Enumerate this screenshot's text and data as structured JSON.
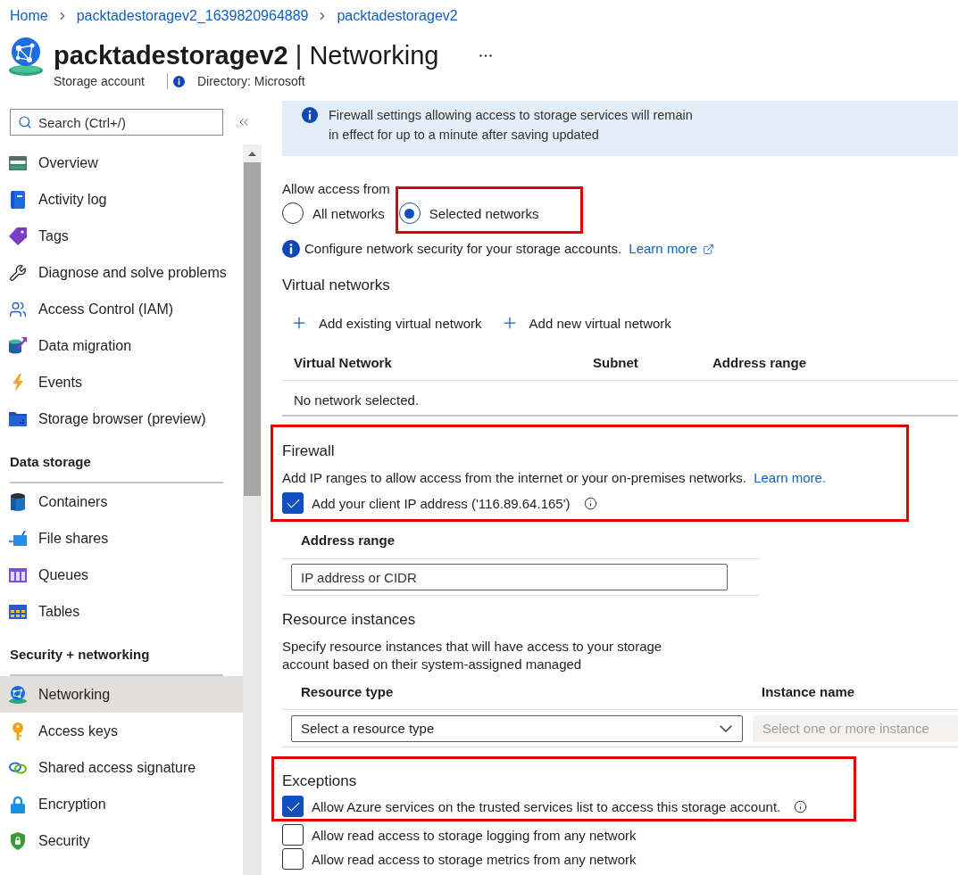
{
  "breadcrumb": [
    "Home",
    "packtadestoragev2_1639820964889",
    "packtadestoragev2"
  ],
  "header": {
    "title": "**packtadestoragev2** | Networking",
    "subtitle": "Storage account",
    "directory": "Directory: Microsoft"
  },
  "sidebar": {
    "search": {
      "placeholder": "Search (Ctrl+/)"
    },
    "sections": [
      {
        "items": [
          {
            "label": "Overview",
            "selected": false
          },
          {
            "label": "Activity log",
            "selected": false
          },
          {
            "label": "Tags",
            "selected": false
          },
          {
            "label": "Diagnose and solve problems",
            "selected": false
          },
          {
            "label": "Access Control (IAM)",
            "selected": false
          },
          {
            "label": "Data migration",
            "selected": false
          },
          {
            "label": "Events",
            "selected": false
          },
          {
            "label": "Storage browser (preview)",
            "selected": false
          }
        ]
      },
      {
        "title": "Data storage",
        "items": [
          {
            "label": "Containers",
            "selected": false
          },
          {
            "label": "File shares",
            "selected": false
          },
          {
            "label": "Queues",
            "selected": false
          },
          {
            "label": "Tables",
            "selected": false
          }
        ]
      },
      {
        "title": "Security + networking",
        "items": [
          {
            "label": "Networking",
            "selected": true
          },
          {
            "label": "Access keys",
            "selected": false
          },
          {
            "label": "Shared access signature",
            "selected": false
          },
          {
            "label": "Encryption",
            "selected": false
          },
          {
            "label": "Security",
            "selected": false
          }
        ]
      }
    ]
  },
  "banner": {
    "lines": [
      "Firewall settings allowing access to storage services will remain",
      "in effect for up to a minute after saving updated"
    ]
  },
  "access": {
    "label": "Allow access from",
    "options": [
      {
        "label": "All networks",
        "selected": false,
        "highlighted": false
      },
      {
        "label": "Selected networks",
        "selected": true,
        "highlighted": true
      }
    ],
    "note": "Configure network security for your storage accounts.",
    "link": "Learn more"
  },
  "virtual_networks": {
    "title": "Virtual networks",
    "actions": [
      "Add existing virtual network",
      "Add new virtual network"
    ],
    "columns": [
      "Virtual Network",
      "Subnet",
      "Address range"
    ],
    "empty_text": "No network selected."
  },
  "firewall": {
    "title": "Firewall",
    "highlighted": true,
    "description": "Add IP ranges to allow access from the internet or your on-premises networks.",
    "link": "Learn more.",
    "client_ip": {
      "label": "Add your client IP address ('116.89.64.165')",
      "checked": true,
      "info": true
    }
  },
  "address_ranges": {
    "column": "Address range",
    "input": {
      "placeholder": "IP address or CIDR"
    }
  },
  "resource_instances": {
    "title": "Resource instances",
    "lines": [
      "Specify resource instances that will have access to your storage",
      "account based on their system-assigned managed"
    ],
    "columns": [
      "Resource type",
      "Instance name"
    ],
    "type_select": {
      "placeholder": "Select a resource type"
    },
    "instance_select": {
      "placeholder": "Select one or more instance",
      "disabled": true
    }
  },
  "exceptions": {
    "title": "Exceptions",
    "options": [
      {
        "label": "Allow Azure services on the trusted services list to access this storage account.",
        "checked": true,
        "highlighted": true,
        "info": true
      },
      {
        "label": "Allow read access to storage logging from any network",
        "checked": false,
        "highlighted": false,
        "info": false
      },
      {
        "label": "Allow read access to storage metrics from any network",
        "checked": false,
        "highlighted": false,
        "info": false
      }
    ]
  }
}
